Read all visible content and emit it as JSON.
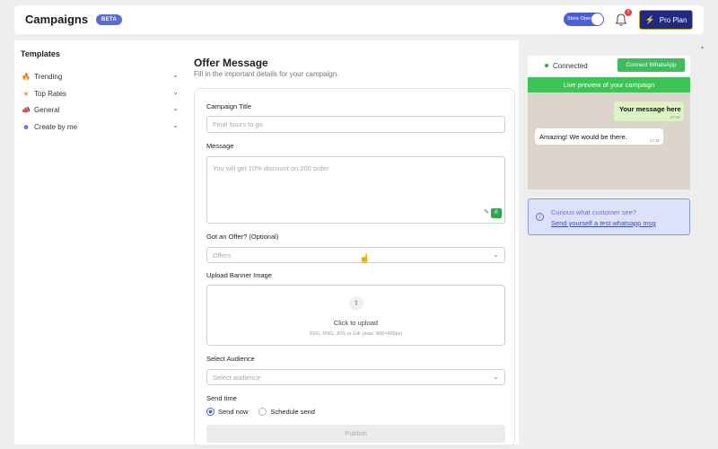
{
  "header": {
    "title": "Campaigns",
    "badge": "BETA",
    "store_toggle": "Store Open",
    "notification_count": "7",
    "pro_label": "Pro Plan"
  },
  "templates": {
    "title": "Templates",
    "items": [
      {
        "label": "Trending",
        "icon": "fire-icon",
        "glyph": "🔥"
      },
      {
        "label": "Top Rates",
        "icon": "star-icon",
        "glyph": "★"
      },
      {
        "label": "General",
        "icon": "megaphone-icon",
        "glyph": "📣"
      },
      {
        "label": "Create by me",
        "icon": "smiley-icon",
        "glyph": "☻"
      }
    ]
  },
  "offer": {
    "title": "Offer Message",
    "subtitle": "Fill in the important details for your campaign.",
    "campaign_title_label": "Campaign Title",
    "campaign_title_placeholder": "Final hours to go",
    "message_label": "Message",
    "message_placeholder": "You will get 10% discount on 200 order",
    "offer_label": "Got an Offer? (Optional)",
    "offer_placeholder": "Offers",
    "upload_label": "Upload Banner Image",
    "upload_cta": "Click to upload",
    "upload_hint": "SVG, PNG, JPG or GIF (max. 800×400px)",
    "audience_label": "Select Audience",
    "audience_placeholder": "Select audience",
    "send_time_label": "Send time",
    "send_now": "Send now",
    "schedule_send": "Schedule send",
    "publish": "Publish"
  },
  "preview": {
    "status": "Connected",
    "connect_button": "Connect WhatsApp",
    "header": "Live preview of your campaign",
    "outgoing": {
      "text": "Your message here",
      "time": "17:31"
    },
    "incoming": {
      "text": "Amazing! We would be there.",
      "time": "17:31"
    },
    "test_question": "Curious what customer see?",
    "test_link": "Send yourself a test whatsapp msg"
  },
  "colors": {
    "accent": "#4b5fd0",
    "whatsapp_green": "#3cc455",
    "pro_button": "#1e2a82"
  }
}
